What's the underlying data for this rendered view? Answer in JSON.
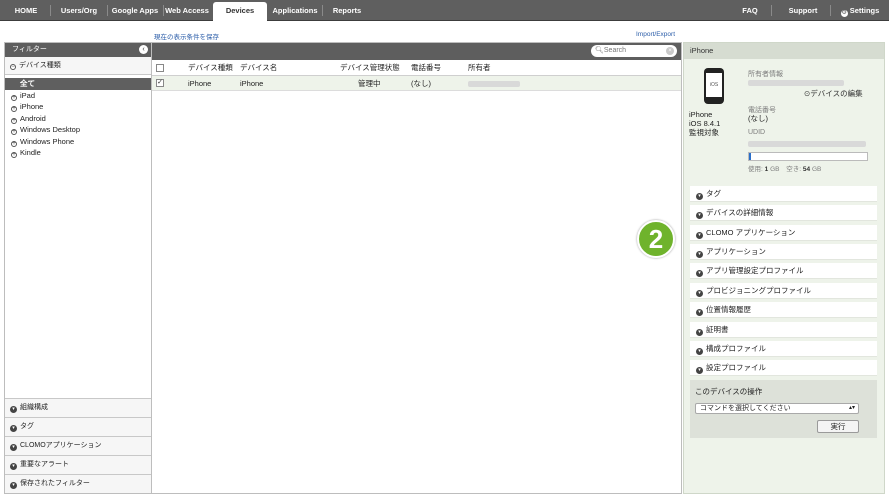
{
  "nav": {
    "tabs": [
      "HOME",
      "Users/Org",
      "Google Apps",
      "Web Access",
      "Devices",
      "Applications",
      "Reports"
    ],
    "active": "Devices",
    "right": [
      "FAQ",
      "Support",
      "Settings"
    ]
  },
  "links": {
    "save_filter": "現在の表示条件を保存",
    "import_export": "Import/Export"
  },
  "left": {
    "header": "フィルター",
    "section": "デバイス種類",
    "categories": [
      "全て",
      "iPad",
      "iPhone",
      "Android",
      "Windows Desktop",
      "Windows Phone",
      "Kindle"
    ],
    "selected": "全て",
    "bottom": [
      "組織構成",
      "タグ",
      "CLOMOアプリケーション",
      "重要なアラート",
      "保存されたフィルター"
    ]
  },
  "center": {
    "search_placeholder": "Search",
    "columns": [
      "デバイス種類",
      "デバイス名",
      "デバイス管理状態",
      "電話番号",
      "所有者"
    ],
    "rows": [
      {
        "type": "iPhone",
        "name": "iPhone",
        "status": "管理中",
        "phone": "(なし)",
        "checked": true
      }
    ]
  },
  "right": {
    "title": "iPhone",
    "device_name": "iPhone",
    "os": "iOS 8.4.1",
    "supervised": "監視対象",
    "screen_label": "iOS",
    "owner_label": "所有者情報",
    "edit_link": "デバイスの編集",
    "phone_label": "電話番号",
    "phone_value": "(なし)",
    "udid_label": "UDID",
    "storage_used_label": "使用:",
    "storage_used_value": "1",
    "storage_free_label": "空き:",
    "storage_free_value": "54",
    "storage_unit": "GB",
    "storage_used_fraction": 0.02,
    "accordion": [
      "タグ",
      "デバイスの詳細情報",
      "CLOMO アプリケーション",
      "アプリケーション",
      "アプリ管理設定プロファイル",
      "プロビジョニングプロファイル",
      "位置情報履歴",
      "証明書",
      "構成プロファイル",
      "設定プロファイル"
    ],
    "ops_title": "このデバイスの操作",
    "command_placeholder": "コマンドを選択してください",
    "run_label": "実行"
  },
  "callout": "2",
  "colors": {
    "nav_bg": "#5f5f5f",
    "callout": "#6fb32c",
    "right_bg": "#eef3ea",
    "storage": "#2a6fc9"
  }
}
